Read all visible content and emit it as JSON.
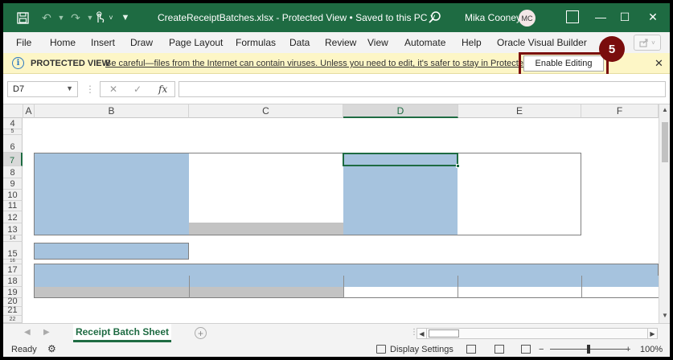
{
  "titlebar": {
    "title": "CreateReceiptBatches.xlsx  -  Protected View  •  Saved to this PC  ˅",
    "user_name": "Mika Cooney",
    "avatar_initials": "MC",
    "save_icon": "save-icon",
    "undo_icon": "undo-icon",
    "redo_icon": "redo-icon",
    "touch_icon": "touch-mode-icon",
    "customize_icon": "customize-qat-icon",
    "minimize": "—",
    "maximize": "☐",
    "close": "✕"
  },
  "menu": {
    "tabs": [
      "File",
      "Home",
      "Insert",
      "Draw",
      "Page Layout",
      "Formulas",
      "Data",
      "Review",
      "View",
      "Automate",
      "Help",
      "Oracle Visual Builder"
    ]
  },
  "protected_view": {
    "title": "PROTECTED VIEW",
    "message": "Be careful—files from the Internet can contain viruses. Unless you need to edit, it's safer to stay in Protected View.",
    "enable_label": "Enable Editing",
    "close": "✕",
    "step_number": "5",
    "highlight_color": "#7a0d0d"
  },
  "formula_bar": {
    "name_box": "D7",
    "formula": "",
    "cancel": "✕",
    "enter": "✓",
    "fx": "fx"
  },
  "grid": {
    "columns": [
      "A",
      "B",
      "C",
      "D",
      "E",
      "F"
    ],
    "selected_column": "D",
    "rows": [
      "4",
      "5",
      "6",
      "7",
      "8",
      "9",
      "10",
      "11",
      "12",
      "13",
      "14",
      "15",
      "16",
      "17",
      "18",
      "19",
      "20",
      "21",
      "22"
    ],
    "selected_row": "7",
    "active_cell": "D7",
    "fill_blue": "#a6c3de",
    "fill_gray": "#c3c3c3"
  },
  "sheets": {
    "active": "Receipt Batch Sheet"
  },
  "status": {
    "ready": "Ready",
    "display_settings": "Display Settings",
    "zoom": "100%",
    "zoom_minus": "−",
    "zoom_plus": "+"
  },
  "accent_color": "#1e6b42"
}
